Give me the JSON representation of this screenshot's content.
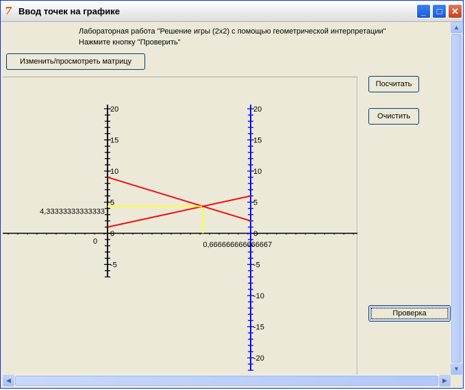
{
  "window": {
    "title": "Ввод точек на графике",
    "icon": "delphi-app-icon",
    "controls": {
      "minimize": "_",
      "maximize": "□",
      "close": "✕"
    }
  },
  "info": {
    "line1": "Лабораторная работа \"Решение игры (2х2) с помощью геометрической интерпретации\"",
    "line2": "Нажмите кнопку \"Проверить\""
  },
  "buttons": {
    "matrix": "Изменить/просмотреть матрицу",
    "calculate": "Посчитать",
    "clear": "Очистить",
    "check": "Проверка"
  },
  "chart_data": {
    "type": "line",
    "left_axis": {
      "color": "#000000",
      "ticks": [
        20,
        15,
        10,
        5,
        0,
        -5
      ],
      "range": [
        -7,
        20
      ]
    },
    "right_axis": {
      "color": "#0000ff",
      "ticks": [
        20,
        15,
        10,
        5,
        0,
        -5,
        -10,
        -15,
        -20
      ],
      "range": [
        -22,
        20
      ]
    },
    "x_origin_label": "0",
    "series": [
      {
        "values": [
          9,
          2
        ],
        "x": [
          0,
          1
        ]
      },
      {
        "values": [
          1,
          6
        ],
        "x": [
          0,
          1
        ]
      }
    ],
    "solution": {
      "x": 0.666666666666667,
      "y": 4.33333333333333
    },
    "x_label": "0,666666666666667",
    "y_label": "4,33333333333333",
    "line_color": "#ee1111",
    "guide_color": "#ffff33"
  }
}
